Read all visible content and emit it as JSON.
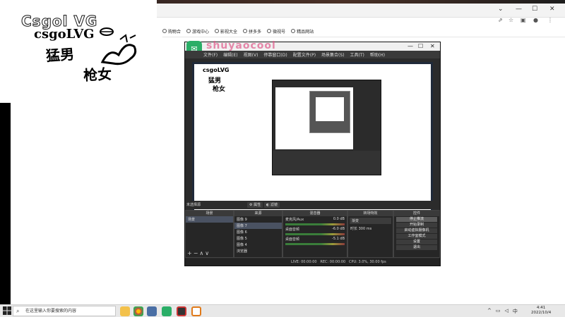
{
  "logo": {
    "ghost_text": "Csgol VG",
    "main_text": "csgoLVG",
    "cn_line1": "猛男",
    "cn_line2": "枪女"
  },
  "bookmarks": [
    {
      "label": "购物合"
    },
    {
      "label": "游戏中心"
    },
    {
      "label": "影视大全"
    },
    {
      "label": "拼多多"
    },
    {
      "label": "微视号"
    },
    {
      "label": "精品网站"
    }
  ],
  "obs": {
    "watermark": "shuyaocool",
    "menu": [
      "文件(F)",
      "编辑(E)",
      "视图(V)",
      "停靠窗口(D)",
      "配置文件(P)",
      "场景集合(S)",
      "工具(T)",
      "帮助(H)"
    ],
    "status_left": "未选择源",
    "toolbar": {
      "properties": "属性",
      "filters": "滤镜"
    },
    "scenes": {
      "header": "场景",
      "items": [
        "场景"
      ]
    },
    "sources": {
      "header": "来源",
      "items": [
        "图像 9",
        "图像 7",
        "图像 6",
        "图像 5",
        "图像 4",
        "浏览器"
      ]
    },
    "mixer": {
      "header": "混音器",
      "channels": [
        {
          "name": "麦克风/Aux",
          "db": "0.0 dB"
        },
        {
          "name": "桌面音频",
          "db": "-6.0 dB"
        },
        {
          "name": "桌面音频",
          "db": "-5.1 dB"
        }
      ]
    },
    "transitions": {
      "header": "转场特效",
      "type": "渐变",
      "duration_label": "时长",
      "duration": "300 ms"
    },
    "controls": {
      "header": "控件",
      "buttons": [
        "停止推流",
        "开始录制",
        "启动虚拟摄像机",
        "工作室模式",
        "设置",
        "退出"
      ]
    },
    "status": {
      "live": "LIVE: 00:00:00",
      "rec": "REC: 00:00:00",
      "cpu": "CPU: 3.0%, 30.00 fps"
    }
  },
  "taskbar": {
    "search_placeholder": "在这里输入你要搜索的内容",
    "clock_time": "4:41",
    "clock_date": "2022/10/4"
  },
  "colors": {
    "obs_bg": "#2b2b2b",
    "wechat_green": "#2aae67",
    "taskbar_bg": "#e8e8e8"
  }
}
